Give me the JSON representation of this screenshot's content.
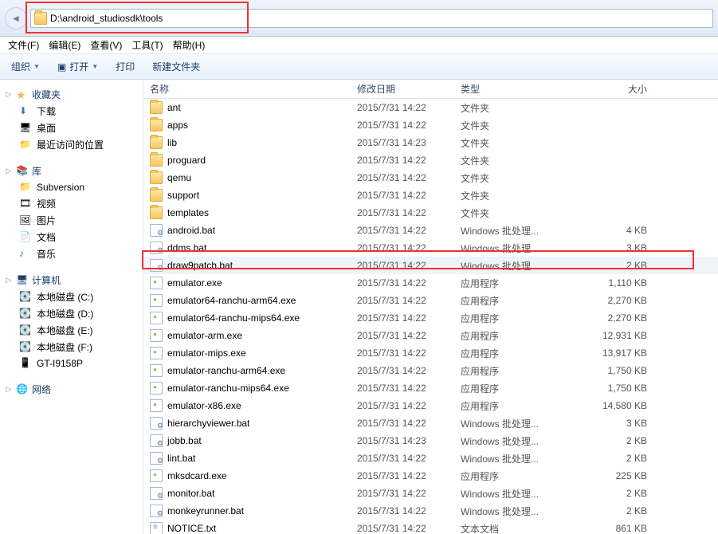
{
  "address": {
    "path": "D:\\android_studiosdk\\tools"
  },
  "menu": {
    "file": "文件(F)",
    "edit": "编辑(E)",
    "view": "查看(V)",
    "tools": "工具(T)",
    "help": "帮助(H)"
  },
  "toolbar": {
    "organize": "组织",
    "open": "打开",
    "print": "打印",
    "newfolder": "新建文件夹"
  },
  "sidebar": {
    "fav": {
      "header": "收藏夹",
      "items": [
        {
          "icon": "dl",
          "label": "下载"
        },
        {
          "icon": "desktop",
          "label": "桌面"
        },
        {
          "icon": "recent",
          "label": "最近访问的位置"
        }
      ]
    },
    "lib": {
      "header": "库",
      "items": [
        {
          "icon": "svn",
          "label": "Subversion"
        },
        {
          "icon": "video",
          "label": "视频"
        },
        {
          "icon": "pic",
          "label": "图片"
        },
        {
          "icon": "doc",
          "label": "文档"
        },
        {
          "icon": "music",
          "label": "音乐"
        }
      ]
    },
    "comp": {
      "header": "计算机",
      "items": [
        {
          "icon": "disk",
          "label": "本地磁盘 (C:)"
        },
        {
          "icon": "disk",
          "label": "本地磁盘 (D:)"
        },
        {
          "icon": "disk",
          "label": "本地磁盘 (E:)"
        },
        {
          "icon": "disk",
          "label": "本地磁盘 (F:)"
        },
        {
          "icon": "phone",
          "label": "GT-I9158P"
        }
      ]
    },
    "net": {
      "header": "网络"
    }
  },
  "columns": {
    "name": "名称",
    "date": "修改日期",
    "type": "类型",
    "size": "大小"
  },
  "files": [
    {
      "icon": "folder",
      "name": "ant",
      "date": "2015/7/31 14:22",
      "type": "文件夹",
      "size": ""
    },
    {
      "icon": "folder",
      "name": "apps",
      "date": "2015/7/31 14:22",
      "type": "文件夹",
      "size": ""
    },
    {
      "icon": "folder",
      "name": "lib",
      "date": "2015/7/31 14:23",
      "type": "文件夹",
      "size": ""
    },
    {
      "icon": "folder",
      "name": "proguard",
      "date": "2015/7/31 14:22",
      "type": "文件夹",
      "size": ""
    },
    {
      "icon": "folder",
      "name": "qemu",
      "date": "2015/7/31 14:22",
      "type": "文件夹",
      "size": ""
    },
    {
      "icon": "folder",
      "name": "support",
      "date": "2015/7/31 14:22",
      "type": "文件夹",
      "size": ""
    },
    {
      "icon": "folder",
      "name": "templates",
      "date": "2015/7/31 14:22",
      "type": "文件夹",
      "size": ""
    },
    {
      "icon": "bat",
      "name": "android.bat",
      "date": "2015/7/31 14:22",
      "type": "Windows 批处理...",
      "size": "4 KB"
    },
    {
      "icon": "bat",
      "name": "ddms.bat",
      "date": "2015/7/31 14:22",
      "type": "Windows 批处理...",
      "size": "3 KB"
    },
    {
      "icon": "bat",
      "name": "draw9patch.bat",
      "date": "2015/7/31 14:22",
      "type": "Windows 批处理...",
      "size": "2 KB",
      "selected": true
    },
    {
      "icon": "exe",
      "name": "emulator.exe",
      "date": "2015/7/31 14:22",
      "type": "应用程序",
      "size": "1,110 KB"
    },
    {
      "icon": "exe",
      "name": "emulator64-ranchu-arm64.exe",
      "date": "2015/7/31 14:22",
      "type": "应用程序",
      "size": "2,270 KB"
    },
    {
      "icon": "exe",
      "name": "emulator64-ranchu-mips64.exe",
      "date": "2015/7/31 14:22",
      "type": "应用程序",
      "size": "2,270 KB"
    },
    {
      "icon": "exe",
      "name": "emulator-arm.exe",
      "date": "2015/7/31 14:22",
      "type": "应用程序",
      "size": "12,931 KB"
    },
    {
      "icon": "exe",
      "name": "emulator-mips.exe",
      "date": "2015/7/31 14:22",
      "type": "应用程序",
      "size": "13,917 KB"
    },
    {
      "icon": "exe",
      "name": "emulator-ranchu-arm64.exe",
      "date": "2015/7/31 14:22",
      "type": "应用程序",
      "size": "1,750 KB"
    },
    {
      "icon": "exe",
      "name": "emulator-ranchu-mips64.exe",
      "date": "2015/7/31 14:22",
      "type": "应用程序",
      "size": "1,750 KB"
    },
    {
      "icon": "exe",
      "name": "emulator-x86.exe",
      "date": "2015/7/31 14:22",
      "type": "应用程序",
      "size": "14,580 KB"
    },
    {
      "icon": "bat",
      "name": "hierarchyviewer.bat",
      "date": "2015/7/31 14:22",
      "type": "Windows 批处理...",
      "size": "3 KB"
    },
    {
      "icon": "bat",
      "name": "jobb.bat",
      "date": "2015/7/31 14:23",
      "type": "Windows 批处理...",
      "size": "2 KB"
    },
    {
      "icon": "bat",
      "name": "lint.bat",
      "date": "2015/7/31 14:22",
      "type": "Windows 批处理...",
      "size": "2 KB"
    },
    {
      "icon": "exe",
      "name": "mksdcard.exe",
      "date": "2015/7/31 14:22",
      "type": "应用程序",
      "size": "225 KB"
    },
    {
      "icon": "bat",
      "name": "monitor.bat",
      "date": "2015/7/31 14:22",
      "type": "Windows 批处理...",
      "size": "2 KB"
    },
    {
      "icon": "bat",
      "name": "monkeyrunner.bat",
      "date": "2015/7/31 14:22",
      "type": "Windows 批处理...",
      "size": "2 KB"
    },
    {
      "icon": "txt",
      "name": "NOTICE.txt",
      "date": "2015/7/31 14:22",
      "type": "文本文档",
      "size": "861 KB"
    }
  ]
}
